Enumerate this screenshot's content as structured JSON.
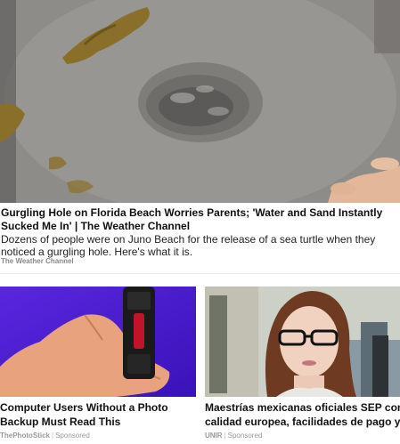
{
  "featured": {
    "title": "Gurgling Hole on Florida Beach Worries Parents; 'Water and Sand Instantly Sucked Me In' | The Weather Channel",
    "description": "Dozens of people were on Juno Beach for the release of a sea turtle when they noticed a gurgling hole. Here's what it is.",
    "source": "The Weather Channel"
  },
  "cards": [
    {
      "title_line1": "Computer Users Without a Photo",
      "title_line2": "Backup Must Read This",
      "source": "ThePhotoStick",
      "sponsored": "Sponsored",
      "separator": "|"
    },
    {
      "title_line1": "Maestrías mexicanas oficiales SEP con",
      "title_line2": "calidad europea, facilidades de pago y…",
      "source": "UNIR",
      "sponsored": "Sponsored",
      "separator": "|"
    }
  ]
}
